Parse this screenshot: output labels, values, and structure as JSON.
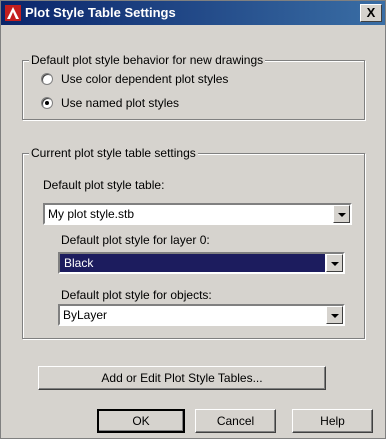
{
  "window": {
    "title": "Plot Style Table Settings",
    "close_glyph": "X"
  },
  "behavior_group": {
    "legend": "Default plot style behavior for new drawings",
    "options": [
      {
        "label": "Use color dependent plot styles",
        "checked": false
      },
      {
        "label": "Use named plot styles",
        "checked": true
      }
    ]
  },
  "current_group": {
    "legend": "Current plot style table settings",
    "default_table_label": "Default plot style table:",
    "default_table_value": "My plot style.stb",
    "layer0_label": "Default plot style for layer 0:",
    "layer0_value": "Black",
    "objects_label": "Default plot style for objects:",
    "objects_value": "ByLayer"
  },
  "buttons": {
    "add_edit": "Add or Edit Plot Style Tables...",
    "ok": "OK",
    "cancel": "Cancel",
    "help": "Help"
  },
  "icons": {
    "app": "autocad-logo-icon",
    "close": "close-icon",
    "dropdown": "chevron-down-icon"
  },
  "colors": {
    "title_bar": "#0a246a",
    "selected_highlight": "#1c1c5e",
    "dialog_face": "#d6d3ce",
    "app_icon": "#c41e1e"
  }
}
